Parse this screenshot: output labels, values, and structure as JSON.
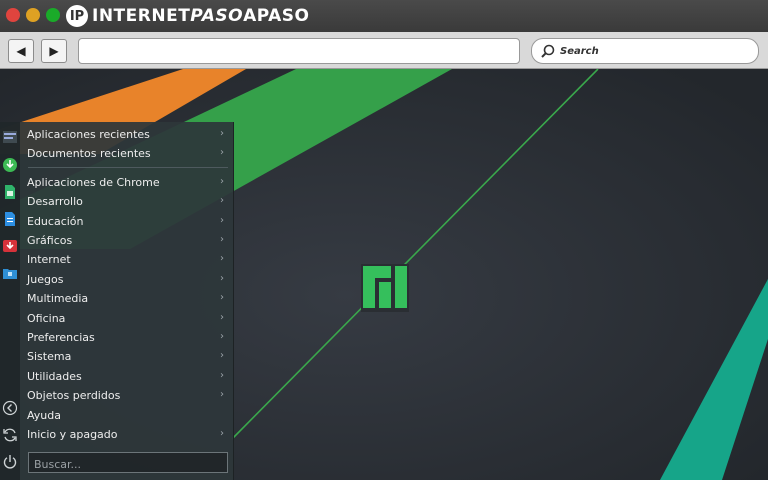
{
  "header": {
    "logo_mark": "IP",
    "logo_text_start": "INTERNET",
    "logo_text_mid": "PASO",
    "logo_text_end": "APASO"
  },
  "toolbar": {
    "back_glyph": "◀",
    "forward_glyph": "▶",
    "url_value": "",
    "search_label": "Search"
  },
  "menu": {
    "items": [
      {
        "label": "Aplicaciones recientes",
        "arrow": "›"
      },
      {
        "label": "Documentos recientes",
        "arrow": "›"
      },
      {
        "label": "Aplicaciones de Chrome",
        "arrow": "›"
      },
      {
        "label": "Desarrollo",
        "arrow": "›"
      },
      {
        "label": "Educación",
        "arrow": "›"
      },
      {
        "label": "Gráficos",
        "arrow": "›"
      },
      {
        "label": "Internet",
        "arrow": "›"
      },
      {
        "label": "Juegos",
        "arrow": "›"
      },
      {
        "label": "Multimedia",
        "arrow": "›"
      },
      {
        "label": "Oficina",
        "arrow": "›"
      },
      {
        "label": "Preferencias",
        "arrow": "›"
      },
      {
        "label": "Sistema",
        "arrow": "›"
      },
      {
        "label": "Utilidades",
        "arrow": "›"
      },
      {
        "label": "Objetos perdidos",
        "arrow": "›"
      },
      {
        "label": "Ayuda",
        "arrow": ""
      },
      {
        "label": "Inicio y apagado",
        "arrow": "›"
      }
    ],
    "search_placeholder": "Buscar..."
  },
  "sidebar_icons": [
    "settings-icon",
    "download-icon",
    "spreadsheet-icon",
    "document-icon",
    "software-store-icon",
    "folder-icon",
    "back-icon",
    "refresh-icon",
    "power-icon"
  ],
  "colors": {
    "orange_stripe": "#e8832a",
    "green_stripe": "#35a04a",
    "teal_stripe": "#16a589",
    "manjaro_green": "#35bf5c"
  }
}
